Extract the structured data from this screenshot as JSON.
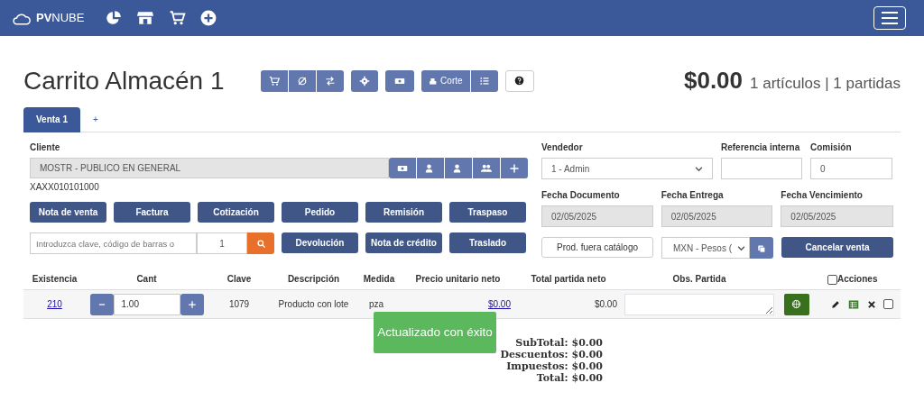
{
  "navbar": {
    "brand": "**PV**NUBE"
  },
  "header": {
    "title": "Carrito Almacén 1",
    "corte_label": "Corte",
    "total": "$0.00",
    "summary": "1 artículos | 1 partidas"
  },
  "tabs": [
    {
      "label": "Venta 1",
      "selected": true
    },
    {
      "label": "+",
      "selected": false
    }
  ],
  "client": {
    "label": "Cliente",
    "value": "MOSTR - PUBLICO EN GENERAL",
    "rfc": "XAXX010101000"
  },
  "doc_buttons": [
    "Nota de venta",
    "Factura",
    "Cotización",
    "Pedido",
    "Remisión",
    "Traspaso"
  ],
  "search": {
    "placeholder": "Introduzca clave, código de barras o",
    "quantity": "1"
  },
  "action_buttons": [
    "Devolución",
    "Nota de crédito",
    "Traslado"
  ],
  "vendor": {
    "label": "Vendedor",
    "value": "1 - Admin"
  },
  "internal_ref": {
    "label": "Referencia interna"
  },
  "commission": {
    "label": "Comisión",
    "value": "0"
  },
  "dates": [
    {
      "label": "Fecha Documento",
      "value": "02/05/2025"
    },
    {
      "label": "Fecha Entrega",
      "value": "02/05/2025"
    },
    {
      "label": "Fecha Vencimiento",
      "value": "02/05/2025"
    }
  ],
  "out_of_catalog_button": "Prod. fuera catálogo",
  "currency": {
    "value": "MXN - Pesos ("
  },
  "cancel_button": "Cancelar venta",
  "table": {
    "columns": [
      "Existencia",
      "Cant",
      "Clave",
      "Descripción",
      "Medida",
      "Precio unitario neto",
      "Total partida neto",
      "Obs. Partida",
      "Acciones"
    ],
    "select_all": false,
    "rows": [
      {
        "existencia": "210",
        "cant": "1.00",
        "clave": "1079",
        "descripcion": "Producto con lote",
        "medida": "pza",
        "precio": "$0.00",
        "total": "$0.00",
        "checked": false
      }
    ]
  },
  "totals": [
    {
      "label": "SubTotal:",
      "value": "$0.00"
    },
    {
      "label": "Descuentos:",
      "value": "$0.00"
    },
    {
      "label": "Impuestos:",
      "value": "$0.00"
    },
    {
      "label": "Total:",
      "value": "$0.00"
    }
  ],
  "toast": "Actualizado con éxito"
}
